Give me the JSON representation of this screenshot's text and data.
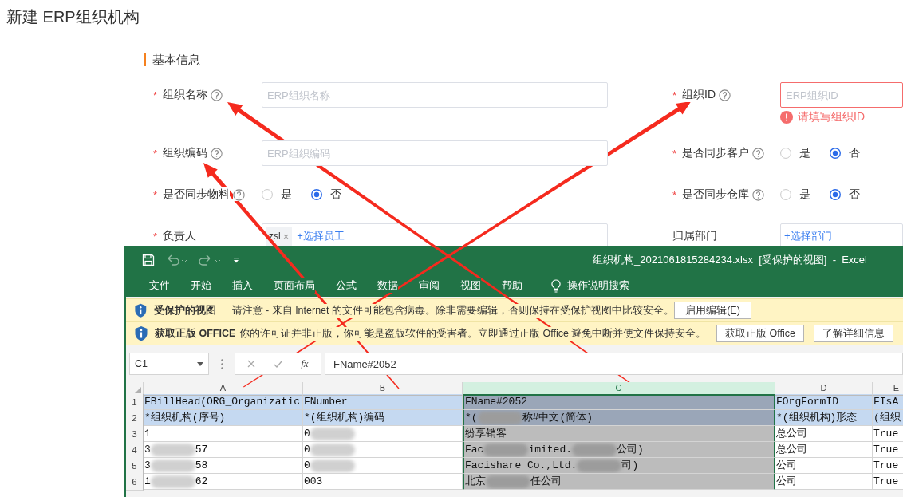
{
  "page_title": "新建 ERP组织机构",
  "section_title": "基本信息",
  "fields": [
    {
      "kind": "input",
      "marker": "*",
      "label": "组织名称",
      "help": true,
      "placeholder": "ERP组织名称"
    },
    {
      "kind": "input",
      "marker": "*",
      "label": "组织ID",
      "help": true,
      "placeholder": "ERP组织ID",
      "error": "请填写组织ID"
    },
    {
      "kind": "input",
      "marker": "*",
      "label": "组织编码",
      "help": true,
      "placeholder": "ERP组织编码"
    },
    {
      "kind": "radio",
      "marker": "*",
      "label": "是否同步客户",
      "help": true,
      "options": [
        {
          "label": "是",
          "selected": false
        },
        {
          "label": "否",
          "selected": true
        }
      ]
    },
    {
      "kind": "radio",
      "marker": "*",
      "label": "是否同步物料",
      "help": true,
      "options": [
        {
          "label": "是",
          "selected": false
        },
        {
          "label": "否",
          "selected": true
        }
      ]
    },
    {
      "kind": "radio",
      "marker": "*",
      "label": "是否同步仓库",
      "help": true,
      "options": [
        {
          "label": "是",
          "selected": false
        },
        {
          "label": "否",
          "selected": true
        }
      ]
    },
    {
      "kind": "picker",
      "marker": "*",
      "label": "负责人",
      "tags": [
        {
          "label": "zsl",
          "remove": "×"
        }
      ],
      "action": "+选择员工"
    },
    {
      "kind": "picker",
      "label": "归属部门",
      "action": "+选择部门"
    }
  ],
  "excel": {
    "title": "组织机构_2021061815284234.xlsx  [受保护的视图]  -  Excel",
    "menu": [
      "文件",
      "开始",
      "插入",
      "页面布局",
      "公式",
      "数据",
      "审阅",
      "视图",
      "帮助"
    ],
    "search_hint": "操作说明搜索",
    "message_bars": [
      {
        "title": "受保护的视图",
        "text": "请注意 - 来自 Internet 的文件可能包含病毒。除非需要编辑，否则保持在受保护视图中比较安全。",
        "buttons": [
          "启用编辑(E)"
        ]
      },
      {
        "title": "获取正版 OFFICE",
        "text": "你的许可证并非正版，你可能是盗版软件的受害者。立即通过正版 Office 避免中断并使文件保持安全。",
        "buttons": [
          "获取正版 Office",
          "了解详细信息"
        ]
      }
    ],
    "name_box": "C1",
    "fx": "fx",
    "formula": "FName#2052",
    "columns": [
      {
        "label": "A",
        "selected": false
      },
      {
        "label": "B",
        "selected": false
      },
      {
        "label": "C",
        "selected": true
      },
      {
        "label": "D",
        "selected": false
      },
      {
        "label": "E",
        "selected": false
      }
    ],
    "rows": [
      {
        "number": "1",
        "kind": "header",
        "cells": [
          [
            {
              "kind": "text",
              "text": "FBillHead(ORG_Organizatic"
            }
          ],
          [
            {
              "kind": "text",
              "text": "FNumber"
            }
          ],
          [
            {
              "kind": "text",
              "text": "FName#2052"
            }
          ],
          [
            {
              "kind": "text",
              "text": "FOrgFormID"
            }
          ],
          [
            {
              "kind": "text",
              "text": "FIsA"
            }
          ]
        ]
      },
      {
        "number": "2",
        "kind": "header",
        "cells": [
          [
            {
              "kind": "text",
              "text": "*组织机构(序号)"
            }
          ],
          [
            {
              "kind": "text",
              "text": "*(组织机构)编码"
            }
          ],
          [
            {
              "kind": "text",
              "text": "*("
            },
            {
              "kind": "blur"
            },
            {
              "kind": "text",
              "text": "称#中文(简体)"
            }
          ],
          [
            {
              "kind": "text",
              "text": "*(组织机构)形态"
            }
          ],
          [
            {
              "kind": "text",
              "text": "(组织"
            }
          ]
        ]
      },
      {
        "number": "3",
        "kind": "data",
        "cells": [
          [
            {
              "kind": "text",
              "text": "1"
            }
          ],
          [
            {
              "kind": "text",
              "text": "0"
            },
            {
              "kind": "blur"
            }
          ],
          [
            {
              "kind": "text",
              "text": "纷享销客"
            }
          ],
          [
            {
              "kind": "text",
              "text": "总公司"
            }
          ],
          [
            {
              "kind": "text",
              "text": "True"
            }
          ]
        ]
      },
      {
        "number": "4",
        "kind": "data",
        "cells": [
          [
            {
              "kind": "text",
              "text": "3"
            },
            {
              "kind": "blur"
            },
            {
              "kind": "text",
              "text": "57"
            }
          ],
          [
            {
              "kind": "text",
              "text": "0"
            },
            {
              "kind": "blur"
            }
          ],
          [
            {
              "kind": "text",
              "text": "Fac"
            },
            {
              "kind": "blur"
            },
            {
              "kind": "text",
              "text": "imited."
            },
            {
              "kind": "blur"
            },
            {
              "kind": "text",
              "text": "公司)"
            }
          ],
          [
            {
              "kind": "text",
              "text": "总公司"
            }
          ],
          [
            {
              "kind": "text",
              "text": "True"
            }
          ]
        ]
      },
      {
        "number": "5",
        "kind": "data",
        "cells": [
          [
            {
              "kind": "text",
              "text": "3"
            },
            {
              "kind": "blur"
            },
            {
              "kind": "text",
              "text": "58"
            }
          ],
          [
            {
              "kind": "text",
              "text": "0"
            },
            {
              "kind": "blur"
            }
          ],
          [
            {
              "kind": "text",
              "text": "Facishare Co.,Ltd."
            },
            {
              "kind": "blur"
            },
            {
              "kind": "text",
              "text": "司)"
            }
          ],
          [
            {
              "kind": "text",
              "text": "公司"
            }
          ],
          [
            {
              "kind": "text",
              "text": "True"
            }
          ]
        ]
      },
      {
        "number": "6",
        "kind": "data",
        "cells": [
          [
            {
              "kind": "text",
              "text": "1"
            },
            {
              "kind": "blur"
            },
            {
              "kind": "text",
              "text": "62"
            }
          ],
          [
            {
              "kind": "text",
              "text": "003"
            }
          ],
          [
            {
              "kind": "text",
              "text": "北京"
            },
            {
              "kind": "blur"
            },
            {
              "kind": "text",
              "text": "任公司"
            }
          ],
          [
            {
              "kind": "text",
              "text": "公司"
            }
          ],
          [
            {
              "kind": "text",
              "text": "True"
            }
          ]
        ]
      }
    ]
  }
}
